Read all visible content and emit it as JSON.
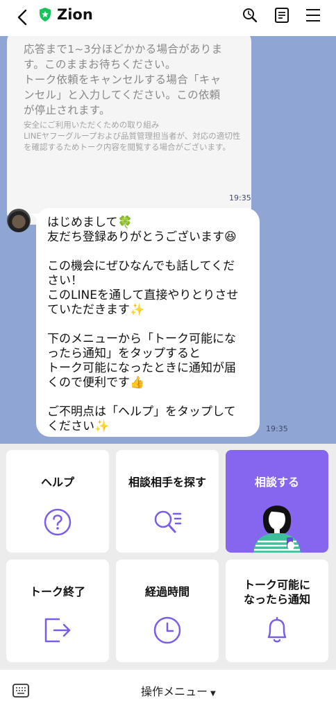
{
  "header": {
    "title": "Zion"
  },
  "chat": {
    "system_message": "応答まで1~3分ほどかかる場合がありま\nす。このままお待ちください。\nトーク依頼をキャンセルする場合「キャ\nンセル」と入力してください。この依頼\nが停止されます。",
    "system_note": "安全にご利用いただくための取り組み\nLINEヤフーグループおよび品質管理担当者が、対応の適切性を確認するためトーク内容を閲覧する場合がございます。",
    "system_time": "19:35",
    "message": "はじめまして🍀\n友だち登録ありがとうございます😆\n\nこの機会にぜひなんでも話してくだ\nさい！\nこのLINEを通して直接やりとりさせ\nていただきます✨\n\n下のメニューから「トーク可能にな\nったら通知」をタップすると\nトーク可能になったときに通知が届\nくので便利です👍\n\nご不明点は「ヘルプ」をタップして\nください✨",
    "message_time": "19:35"
  },
  "menu": {
    "help": "ヘルプ",
    "find_partner": "相談相手を探す",
    "consult": "相談する",
    "end_talk": "トーク終了",
    "elapsed": "経過時間",
    "notify": "トーク可能に\nなったら通知"
  },
  "bottom": {
    "menu_label": "操作メニュー"
  },
  "colors": {
    "accent": "#8666ee",
    "chat_bg": "#8fa6d4",
    "menu_bg": "#ececec"
  }
}
